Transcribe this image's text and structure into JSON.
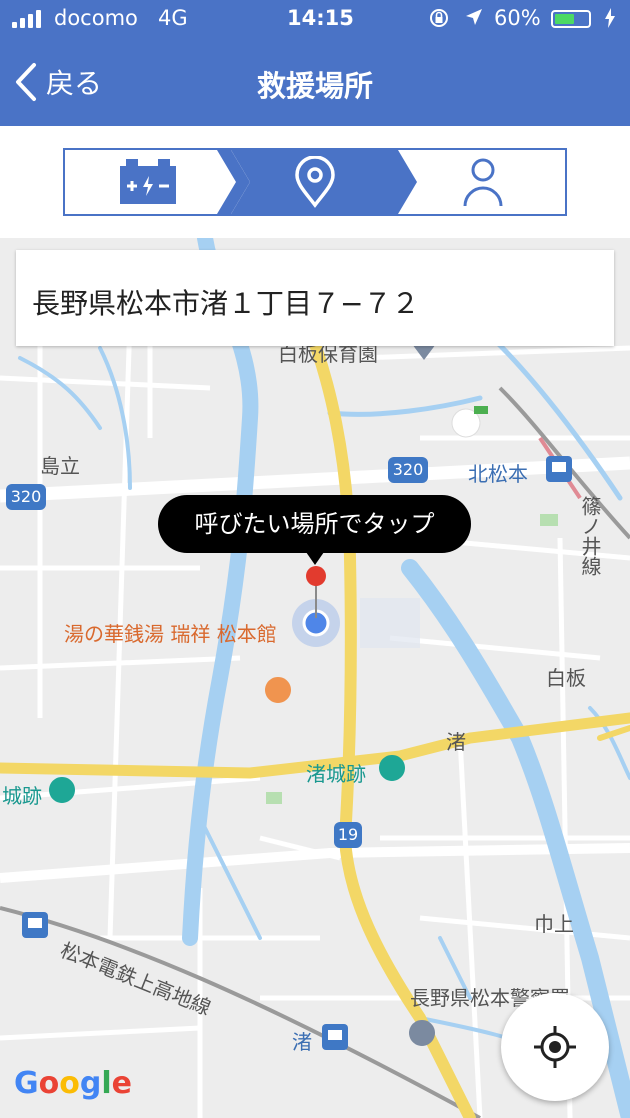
{
  "status_bar": {
    "carrier": "docomo",
    "network": "4G",
    "time": "14:15",
    "battery": "60%",
    "battery_level": 0.6
  },
  "nav": {
    "back_label": "戻る",
    "title": "救援場所"
  },
  "steps": [
    {
      "icon": "battery-icon"
    },
    {
      "icon": "location-pin-icon",
      "active": true
    },
    {
      "icon": "person-icon"
    }
  ],
  "map": {
    "address": "長野県松本市渚１丁目７−７２",
    "tooltip": "呼びたい場所でタップ",
    "labels": {
      "kindergarten": "白板保育園",
      "shimadachi": "島立",
      "kitamatsumoto": "北松本",
      "shinonoi_line": "篠ノ井線",
      "yunohana": "湯の華銭湯 瑞祥 松本館",
      "shirakita": "白板",
      "nagisa_area": "渚",
      "nagisa_castle": "渚城跡",
      "castle_left": "城跡",
      "railway": "松本電鉄上高地線",
      "kamiyama": "巾上",
      "police": "長野県松本警察署",
      "nagisa_station": "渚",
      "google": "Google"
    },
    "routes": {
      "r320_left": "320",
      "r320_right": "320",
      "r19": "19"
    }
  },
  "colors": {
    "header": "#4a73c6",
    "accent": "#4a73c6",
    "road_yellow": "#f3d766",
    "river": "#a6d0f2"
  }
}
